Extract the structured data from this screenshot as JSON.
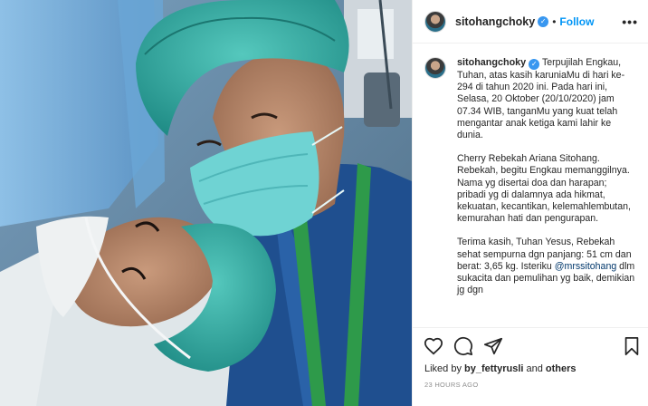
{
  "post": {
    "username": "sitohangchoky",
    "follow_label": "Follow",
    "separator": "•",
    "more_label": "•••",
    "verified_mark": "✓"
  },
  "caption": {
    "paragraph_1": "Terpujilah Engkau, Tuhan, atas kasih karuniaMu di hari ke-294 di tahun 2020 ini. Pada hari ini, Selasa, 20 Oktober (20/10/2020) jam 07.34 WIB, tanganMu yang kuat telah mengantar anak ketiga kami lahir ke dunia.",
    "paragraph_2": "Cherry Rebekah Ariana Sitohang. Rebekah, begitu Engkau memanggilnya. Nama yg disertai doa dan harapan; pribadi yg di dalamnya ada hikmat, kekuatan, kecantikan, kelemahlembutan, kemurahan hati dan pengurapan.",
    "paragraph_3_before": "Terima kasih, Tuhan Yesus, Rebekah sehat sempurna dgn panjang: 51 cm dan berat: 3,65 kg. Isteriku ",
    "mention": "@mrssitohang",
    "paragraph_3_after": " dlm sukacita dan pemulihan yg baik, demikian jg dgn"
  },
  "engagement": {
    "liked_by_prefix": "Liked by ",
    "liked_by_user": "by_fettyrusli",
    "liked_by_conjunction": " and ",
    "liked_by_others": "others",
    "timestamp": "23 HOURS AGO"
  },
  "icons": {
    "like": "heart-icon",
    "comment": "comment-icon",
    "share": "share-icon",
    "save": "bookmark-icon",
    "more": "more-options-icon",
    "verified": "verified-badge-icon"
  },
  "colors": {
    "follow": "#0095f6",
    "verified": "#3897f0",
    "mention": "#00376b",
    "timestamp": "#8e8e8e",
    "surgical_cap": "#2fa7a0",
    "scrubs": "#1f4f8f",
    "lanyard": "#2e9a4a"
  }
}
